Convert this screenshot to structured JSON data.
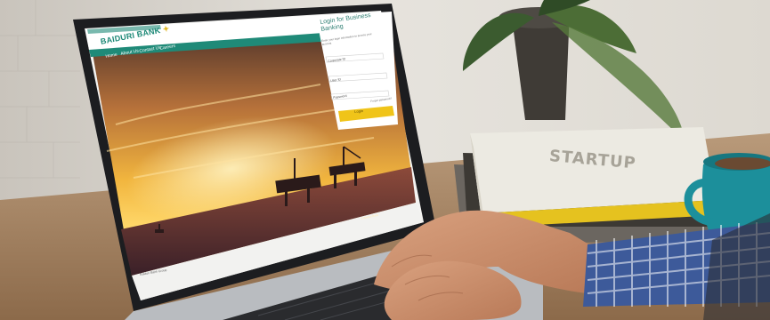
{
  "website": {
    "brand": "BAIDURI BANK",
    "nav": [
      "Home",
      "About Us",
      "Contact Us",
      "Careers"
    ],
    "login": {
      "title": "Login for Business Banking",
      "subtitle": "Enter your login information to access your account",
      "fields": [
        {
          "label": "Corporate ID"
        },
        {
          "label": "User ID"
        },
        {
          "label": "Password"
        }
      ],
      "link": "Forgot password?",
      "button": "Login"
    },
    "caption": "© Baiduri Bank",
    "footer": "Baiduri Bank Group"
  },
  "book": {
    "title": "STARTUP"
  },
  "colors": {
    "brand_green": "#1f8a78",
    "login_button": "#f0c419",
    "mug": "#1c8f9b",
    "shirt": "#3d5a9a",
    "book_spine": "#e5c21f"
  }
}
